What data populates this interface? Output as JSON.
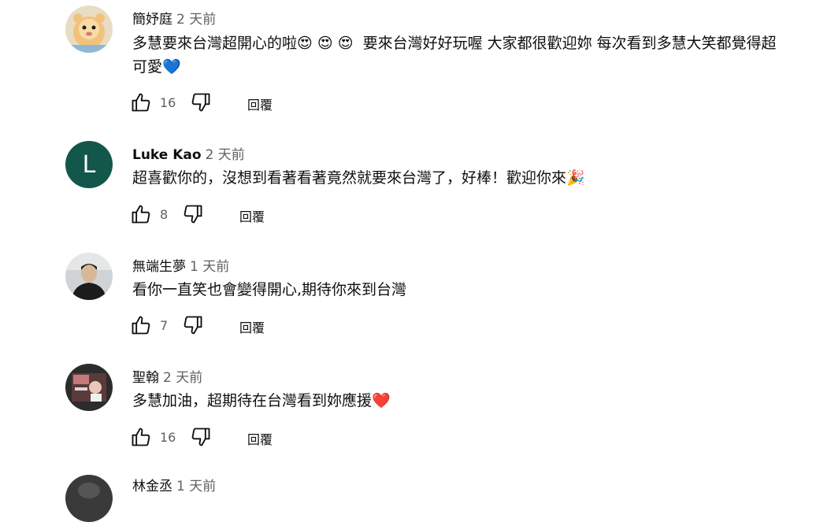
{
  "comments": [
    {
      "author": "簡妤庭",
      "time": "2 天前",
      "text": "多慧要來台灣超開心的啦😍 😍 😍  要來台灣好好玩喔 大家都很歡迎妳 每次看到多慧大笑都覺得超可愛💙",
      "likes": "16",
      "reply_label": "回覆",
      "avatar": "cartoon-avatar"
    },
    {
      "author": "Luke Kao",
      "time": "2 天前",
      "text": "超喜歡你的，沒想到看著看著竟然就要來台灣了，好棒！歡迎你來🎉",
      "likes": "8",
      "reply_label": "回覆",
      "avatar_letter": "L",
      "avatar_color": "#13574a"
    },
    {
      "author": "無端生夢",
      "time": "1 天前",
      "text": "看你一直笑也會變得開心,期待你來到台灣",
      "likes": "7",
      "reply_label": "回覆",
      "avatar": "photo-avatar"
    },
    {
      "author": "聖翰",
      "time": "2 天前",
      "text": "多慧加油，超期待在台灣看到妳應援❤️",
      "likes": "16",
      "reply_label": "回覆",
      "avatar": "photo-avatar"
    },
    {
      "author": "林金丞",
      "time": "1 天前"
    }
  ],
  "icons": {
    "like": "thumbs-up-icon",
    "dislike": "thumbs-down-icon"
  },
  "colors": {
    "text": "#0f0f0f",
    "secondary": "#606060",
    "avatar_green": "#13574a"
  }
}
